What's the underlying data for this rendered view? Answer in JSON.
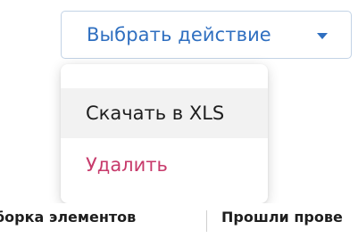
{
  "action_dropdown": {
    "label": "Выбрать действие",
    "caret_icon": "chevron-down-icon",
    "accent_color": "#2f6fc0"
  },
  "menu": {
    "items": [
      {
        "label": "Скачать в XLS",
        "highlighted": true
      },
      {
        "label": "Удалить",
        "color": "#c73a6b"
      }
    ]
  },
  "table": {
    "headers": [
      "борка элементов",
      "Прошли прове"
    ]
  }
}
